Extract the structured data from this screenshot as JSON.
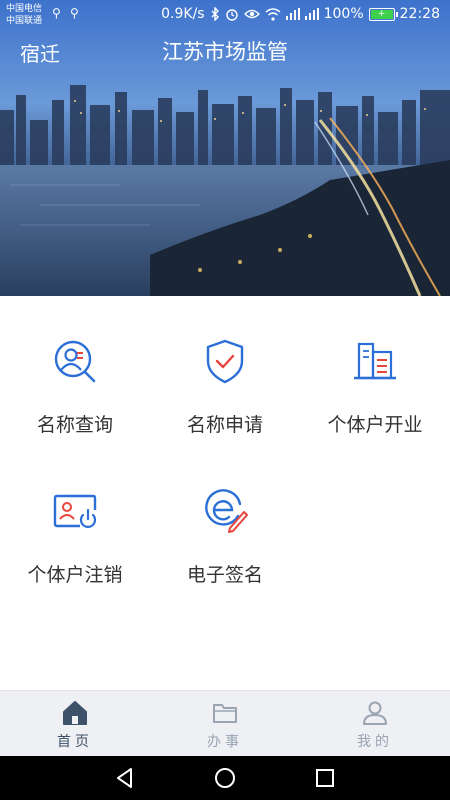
{
  "status_bar": {
    "carrier_1": "中国电信",
    "carrier_2": "中国联通",
    "network_speed": "0.9K/s",
    "battery": "100%",
    "time": "22:28"
  },
  "header": {
    "city": "宿迁",
    "title": "江苏市场监管"
  },
  "colors": {
    "accent_blue": "#2c6fd6",
    "accent_red": "#e8453c",
    "tab_active": "#3d5168",
    "tab_inactive": "#9aa4b2"
  },
  "services": [
    {
      "label": "名称查询",
      "icon": "name-search-icon"
    },
    {
      "label": "名称申请",
      "icon": "shield-check-icon"
    },
    {
      "label": "个体户开业",
      "icon": "buildings-icon"
    },
    {
      "label": "个体户注销",
      "icon": "id-card-power-icon"
    },
    {
      "label": "电子签名",
      "icon": "e-signature-icon"
    }
  ],
  "tabs": [
    {
      "label": "首页",
      "icon": "home-icon",
      "active": true
    },
    {
      "label": "办事",
      "icon": "folder-icon",
      "active": false
    },
    {
      "label": "我的",
      "icon": "user-icon",
      "active": false
    }
  ]
}
